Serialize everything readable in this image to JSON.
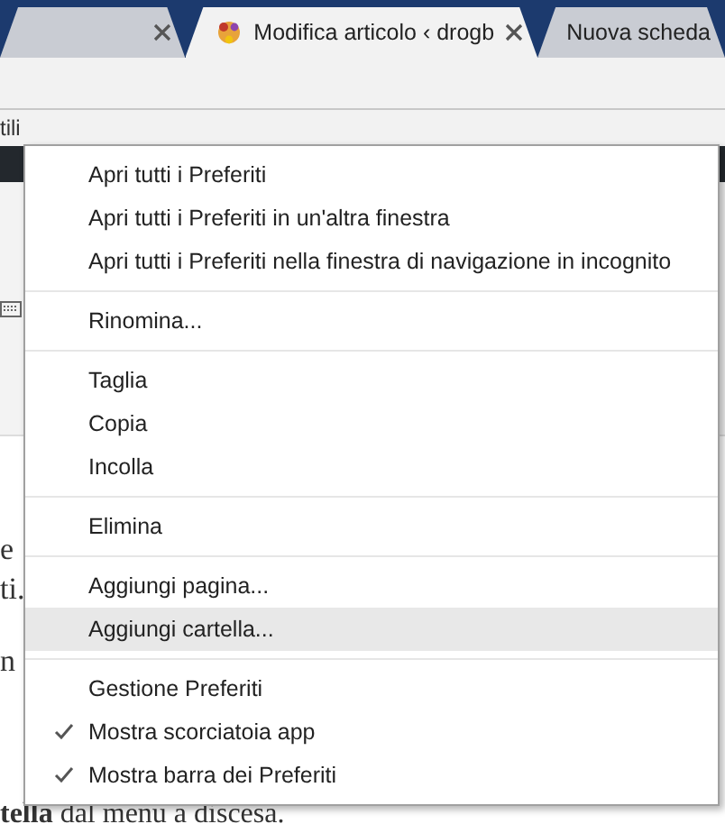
{
  "tabs": [
    {
      "selected": false
    },
    {
      "title": "Modifica articolo ‹ drogb",
      "selected": true
    },
    {
      "title": "Nuova scheda",
      "selected": false
    }
  ],
  "bookmarks_bar": {
    "text": "tili"
  },
  "page_fragments": [
    "e",
    "ti.",
    "n"
  ],
  "page_last_line": "**tella** dal menu a discesa.",
  "context_menu": {
    "sections": [
      {
        "items": [
          {
            "label": "Apri tutti i Preferiti",
            "selected": false
          },
          {
            "label": "Apri tutti i Preferiti in un'altra finestra",
            "selected": false
          },
          {
            "label": "Apri tutti i Preferiti nella finestra di navigazione in incognito",
            "selected": false
          }
        ]
      },
      {
        "items": [
          {
            "label": "Rinomina...",
            "selected": false
          }
        ]
      },
      {
        "items": [
          {
            "label": "Taglia",
            "selected": false
          },
          {
            "label": "Copia",
            "selected": false
          },
          {
            "label": "Incolla",
            "selected": false
          }
        ]
      },
      {
        "items": [
          {
            "label": "Elimina",
            "selected": false
          }
        ]
      },
      {
        "items": [
          {
            "label": "Aggiungi pagina...",
            "selected": false
          },
          {
            "label": "Aggiungi cartella...",
            "selected": true
          }
        ]
      },
      {
        "items": [
          {
            "label": "Gestione Preferiti",
            "selected": false,
            "checked": false
          },
          {
            "label": "Mostra scorciatoia app",
            "selected": false,
            "checked": true
          },
          {
            "label": "Mostra barra dei Preferiti",
            "selected": false,
            "checked": true
          }
        ]
      }
    ]
  }
}
